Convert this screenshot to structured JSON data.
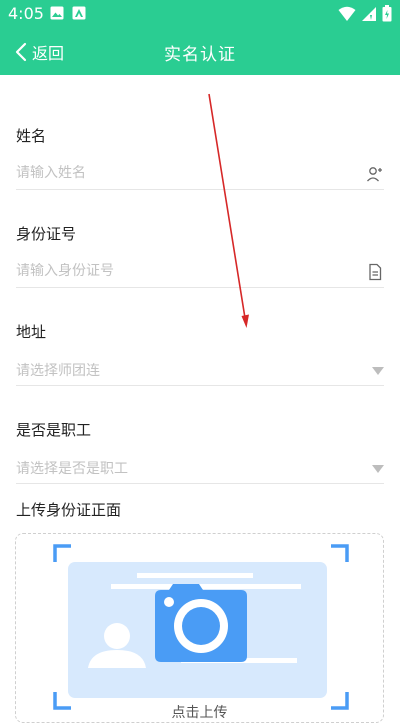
{
  "status_bar": {
    "time": "4:05",
    "left_icons": [
      "image-icon",
      "photo-icon"
    ],
    "right_icons": [
      "wifi-icon",
      "signal-icon",
      "battery-icon"
    ]
  },
  "app_bar": {
    "back_label": "返回",
    "title": "实名认证",
    "background": "#2acd92"
  },
  "form": {
    "name": {
      "label": "姓名",
      "placeholder": "请输入姓名",
      "icon": "add-contact-icon"
    },
    "id_number": {
      "label": "身份证号",
      "placeholder": "请输入身份证号",
      "icon": "document-icon"
    },
    "address": {
      "label": "地址",
      "value": "请选择师团连",
      "icon": "dropdown-icon"
    },
    "is_employee": {
      "label": "是否是职工",
      "value": "请选择是否是职工",
      "icon": "dropdown-icon"
    },
    "upload_front": {
      "label": "上传身份证正面",
      "hint": "点击上传",
      "accent": "#4a9cf5"
    }
  }
}
